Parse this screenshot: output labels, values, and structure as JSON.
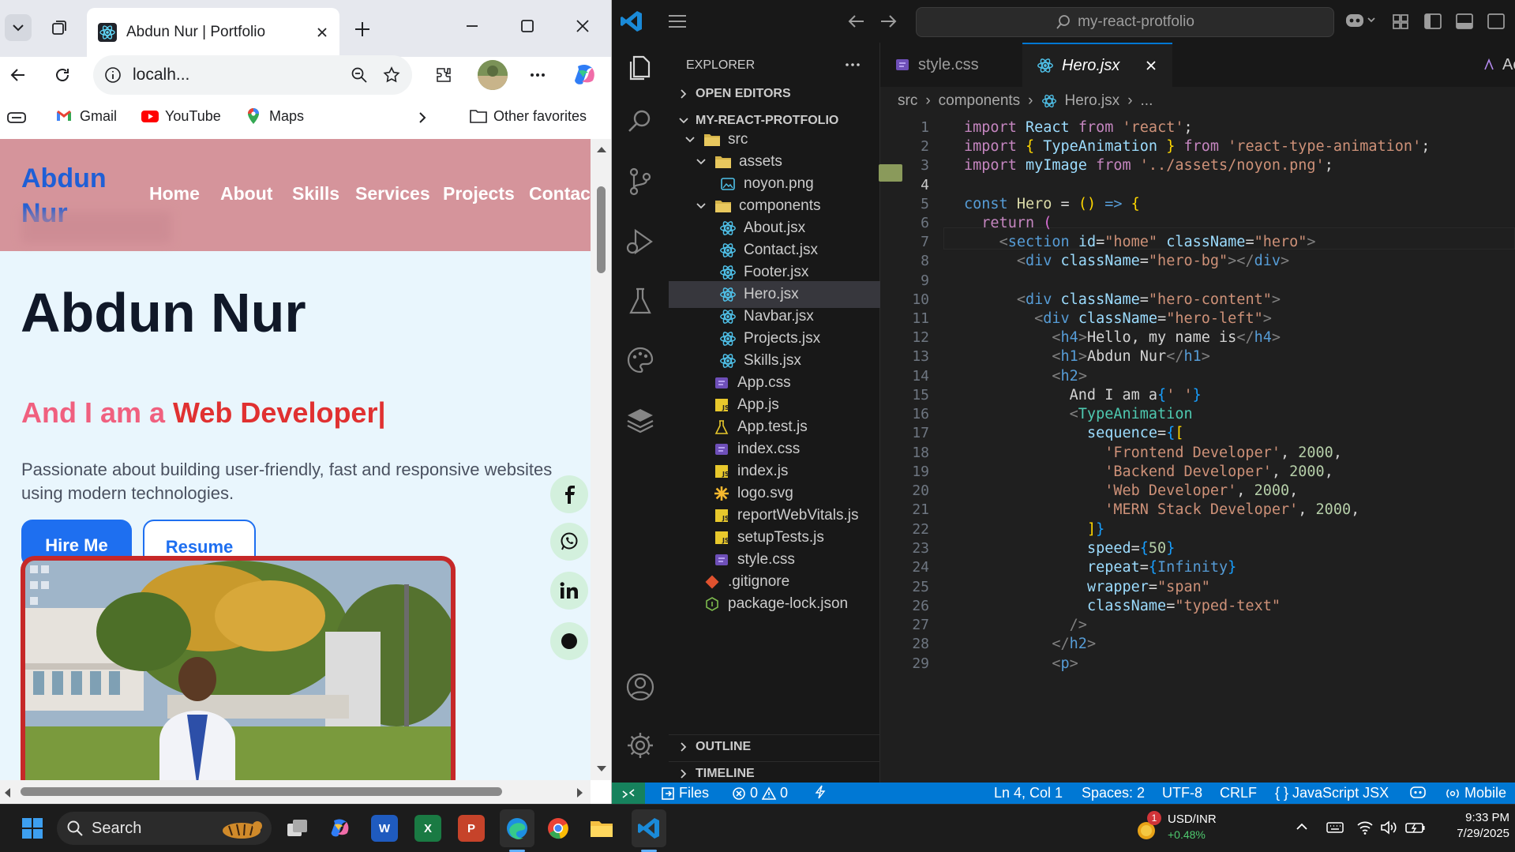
{
  "browser": {
    "tab_title": "Abdun Nur | Portfolio",
    "address": "localh...",
    "favorites": {
      "gmail": "Gmail",
      "youtube": "YouTube",
      "maps": "Maps",
      "other": "Other favorites"
    },
    "page": {
      "brand": "Abdun Nur",
      "nav": [
        "Home",
        "About",
        "Skills",
        "Services",
        "Projects",
        "Contact"
      ],
      "hero_name": "Abdun Nur",
      "hero_prefix": "And I am a ",
      "hero_role": "Web Developer|",
      "hero_desc": "Passionate about building user-friendly, fast and responsive websites using modern technologies.",
      "hire_label": "Hire Me",
      "resume_label": "Resume",
      "social": [
        "f",
        "whatsapp",
        "in",
        "github"
      ]
    }
  },
  "vscode": {
    "search_label": "my-react-protfolio",
    "explorer_title": "EXPLORER",
    "open_editors": "OPEN EDITORS",
    "project": "MY-REACT-PROTFOLIO",
    "tree": [
      {
        "name": "src",
        "kind": "folder"
      },
      {
        "name": "assets",
        "kind": "folder"
      },
      {
        "name": "noyon.png",
        "kind": "image"
      },
      {
        "name": "components",
        "kind": "folder"
      },
      {
        "name": "About.jsx",
        "kind": "react"
      },
      {
        "name": "Contact.jsx",
        "kind": "react"
      },
      {
        "name": "Footer.jsx",
        "kind": "react"
      },
      {
        "name": "Hero.jsx",
        "kind": "react"
      },
      {
        "name": "Navbar.jsx",
        "kind": "react"
      },
      {
        "name": "Projects.jsx",
        "kind": "react"
      },
      {
        "name": "Skills.jsx",
        "kind": "react"
      },
      {
        "name": "App.css",
        "kind": "css"
      },
      {
        "name": "App.js",
        "kind": "js"
      },
      {
        "name": "App.test.js",
        "kind": "test"
      },
      {
        "name": "index.css",
        "kind": "css"
      },
      {
        "name": "index.js",
        "kind": "js"
      },
      {
        "name": "logo.svg",
        "kind": "svg"
      },
      {
        "name": "reportWebVitals.js",
        "kind": "js"
      },
      {
        "name": "setupTests.js",
        "kind": "js"
      },
      {
        "name": "style.css",
        "kind": "css"
      },
      {
        "name": ".gitignore",
        "kind": "git"
      },
      {
        "name": "package-lock.json",
        "kind": "json"
      }
    ],
    "outline": "OUTLINE",
    "timeline": "TIMELINE",
    "tabs": [
      "style.css",
      "Hero.jsx"
    ],
    "tab_overflow": "Act",
    "breadcrumb": [
      "src",
      "components",
      "Hero.jsx",
      "..."
    ],
    "line_numbers": [
      "1",
      "2",
      "3",
      "4",
      "5",
      "6",
      "7",
      "8",
      "9",
      "10",
      "11",
      "12",
      "13",
      "14",
      "15",
      "16",
      "17",
      "18",
      "19",
      "20",
      "21",
      "22",
      "23",
      "24",
      "25",
      "26",
      "27",
      "28",
      "29"
    ],
    "status": {
      "files": "Files",
      "errors": "0",
      "warnings": "0",
      "position": "Ln 4, Col 1",
      "spaces": "Spaces: 2",
      "encoding": "UTF-8",
      "eol": "CRLF",
      "language": "JavaScript JSX",
      "mobile": "Mobile"
    }
  },
  "taskbar": {
    "search": "Search",
    "stock_name": "USD/INR",
    "stock_change": "+0.48%",
    "badge": "1",
    "time": "9:33 PM",
    "date": "7/29/2025"
  }
}
